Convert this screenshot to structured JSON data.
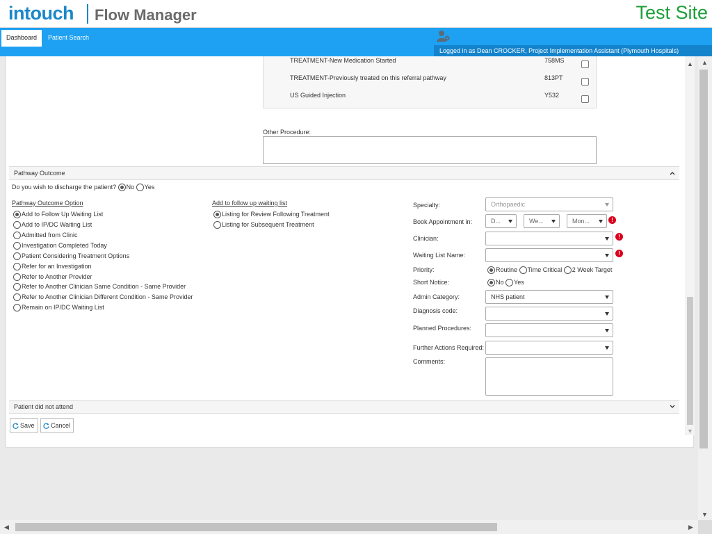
{
  "header": {
    "logo_brand": "intouch",
    "logo_product": "Flow Manager",
    "site_label": "Test Site"
  },
  "nav": {
    "tabs": [
      {
        "label": "Dashboard",
        "active": true
      },
      {
        "label": "Patient Search",
        "active": false
      }
    ],
    "user_icon": "user-settings-icon",
    "logged_in": "Logged in as Dean CROCKER, Project Implementation Assistant (Plymouth Hospitals)"
  },
  "procedures": [
    {
      "label": "TREATMENT-New Medication Started",
      "code": "758MS",
      "checked": false
    },
    {
      "label": "TREATMENT-Previously treated on this referral pathway",
      "code": "813PT",
      "checked": false
    },
    {
      "label": "US Guided Injection",
      "code": "Y532",
      "checked": false
    }
  ],
  "other_procedure_label": "Other Procedure:",
  "pathway_outcome": {
    "title": "Pathway Outcome",
    "discharge_question": "Do you wish to discharge the patient?",
    "discharge_options": [
      "No",
      "Yes"
    ],
    "discharge_selected": "No",
    "outcome_option_title": "Pathway Outcome Option",
    "outcome_options": [
      "Add to Follow Up Waiting List",
      "Add to IP/DC Waiting List",
      "Admitted from Clinic",
      "Investigation Completed Today",
      "Patient Considering Treatment Options",
      "Refer for an Investigation",
      "Refer to Another Provider",
      "Refer to Another Clinician Same Condition - Same Provider",
      "Refer to Another Clinician Different Condition - Same Provider",
      "Remain on IP/DC Waiting List"
    ],
    "outcome_selected": "Add to Follow Up Waiting List",
    "followup_title": "Add to follow up waiting list",
    "followup_options": [
      "Listing for Review Following Treatment",
      "Listing for Subsequent Treatment"
    ],
    "followup_selected": "Listing for Review Following Treatment"
  },
  "form": {
    "specialty": {
      "label": "Specialty:",
      "value": "Orthopaedic"
    },
    "book_appointment": {
      "label": "Book Appointment in:",
      "values": [
        "D...",
        "We...",
        "Mon..."
      ]
    },
    "clinician": {
      "label": "Clinician:",
      "value": ""
    },
    "waiting_list_name": {
      "label": "Waiting List Name:",
      "value": ""
    },
    "priority": {
      "label": "Priority:",
      "options": [
        "Routine",
        "Time Critical",
        "2 Week Target"
      ],
      "selected": "Routine"
    },
    "short_notice": {
      "label": "Short Notice:",
      "options": [
        "No",
        "Yes"
      ],
      "selected": "No"
    },
    "admin_category": {
      "label": "Admin Category:",
      "value": "NHS patient"
    },
    "diagnosis_code": {
      "label": "Diagnosis code:",
      "value": ""
    },
    "planned_procedures": {
      "label": "Planned Procedures:",
      "value": ""
    },
    "further_actions": {
      "label": "Further Actions Required:",
      "value": ""
    },
    "comments": {
      "label": "Comments:",
      "value": ""
    }
  },
  "dna_section": {
    "title": "Patient did not attend"
  },
  "buttons": {
    "save": "Save",
    "cancel": "Cancel"
  },
  "colors": {
    "brand_blue": "#1a87c8",
    "nav_blue": "#1ea1f2",
    "test_site_green": "#1e9e3a",
    "warning_red": "#d9001b"
  }
}
